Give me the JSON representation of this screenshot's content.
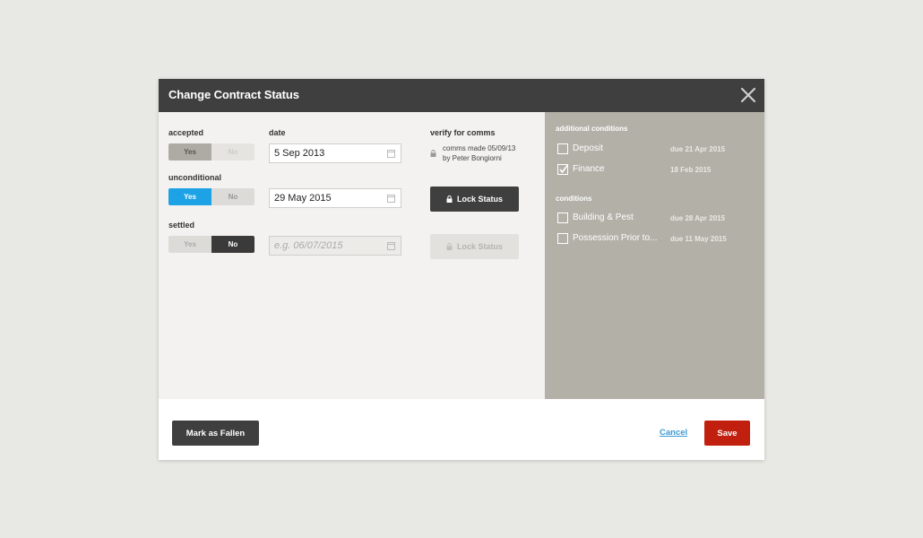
{
  "modal": {
    "title": "Change Contract Status"
  },
  "fields": {
    "accepted": {
      "label": "accepted",
      "yes": "Yes",
      "no": "No",
      "date": "5 Sep 2013"
    },
    "unconditional": {
      "label": "unconditional",
      "yes": "Yes",
      "no": "No",
      "date": "29 May 2015"
    },
    "settled": {
      "label": "settled",
      "yes": "Yes",
      "no": "No",
      "date_placeholder": "e.g. 06/07/2015"
    }
  },
  "date_col": {
    "label": "date"
  },
  "verify": {
    "label": "verify for comms",
    "line1": "comms made 05/09/13",
    "line2": "by Peter Bongiorni",
    "lock_label": "Lock Status",
    "lock_label_disabled": "Lock Status"
  },
  "additional": {
    "heading": "additional conditions",
    "items": [
      {
        "name": "Deposit",
        "due": "due 21 Apr 2015",
        "checked": false
      },
      {
        "name": "Finance",
        "due": "18 Feb 2015",
        "checked": true
      }
    ]
  },
  "conditions": {
    "heading": "conditions",
    "items": [
      {
        "name": "Building & Pest",
        "due": "due 28 Apr 2015",
        "checked": false
      },
      {
        "name": "Possession Prior to...",
        "due": "due 11 May 2015",
        "checked": false
      }
    ]
  },
  "footer": {
    "fallen_label": "Mark as Fallen",
    "cancel_label": "Cancel",
    "save_label": "Save"
  },
  "colors": {
    "header": "#3f3f3f",
    "accent_blue": "#1ea2e6",
    "save_red": "#c2200f",
    "link_blue": "#3a9ad4",
    "conditions_bg": "#b3b0a8"
  }
}
